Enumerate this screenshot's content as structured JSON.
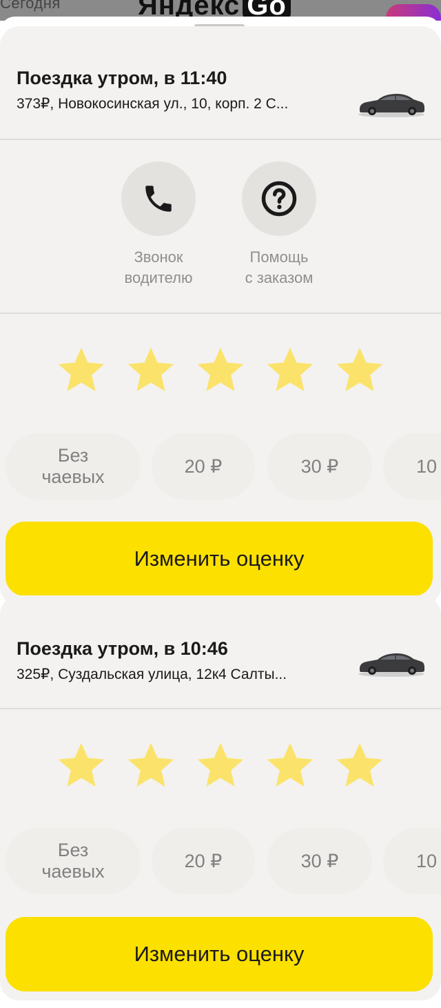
{
  "header": {
    "today_label": "Сегодня",
    "brand_name": "Яндекс",
    "brand_suffix": "Go"
  },
  "colors": {
    "accent": "#fce000",
    "star": "#fbe36b",
    "card": "#f3f2f0"
  },
  "trips": [
    {
      "title": "Поездка утром, в 11:40",
      "subtitle": "373₽, Новокосинская ул., 10, корп. 2 С...",
      "car_icon": "car-icon",
      "actions": [
        {
          "icon": "phone-icon",
          "label_line1": "Звонок",
          "label_line2": "водителю"
        },
        {
          "icon": "help-icon",
          "label_line1": "Помощь",
          "label_line2": "с заказом"
        }
      ],
      "rating": 5,
      "tips": [
        {
          "line1": "Без",
          "line2": "чаевых"
        },
        {
          "line1": "20 ₽",
          "line2": ""
        },
        {
          "line1": "30 ₽",
          "line2": ""
        },
        {
          "line1": "10",
          "line2": ""
        }
      ],
      "button_label": "Изменить оценку"
    },
    {
      "title": "Поездка утром, в 10:46",
      "subtitle": "325₽, Суздальская улица, 12к4 Салты...",
      "car_icon": "car-icon",
      "rating": 5,
      "tips": [
        {
          "line1": "Без",
          "line2": "чаевых"
        },
        {
          "line1": "20 ₽",
          "line2": ""
        },
        {
          "line1": "30 ₽",
          "line2": ""
        },
        {
          "line1": "10",
          "line2": ""
        }
      ],
      "button_label": "Изменить оценку"
    }
  ]
}
